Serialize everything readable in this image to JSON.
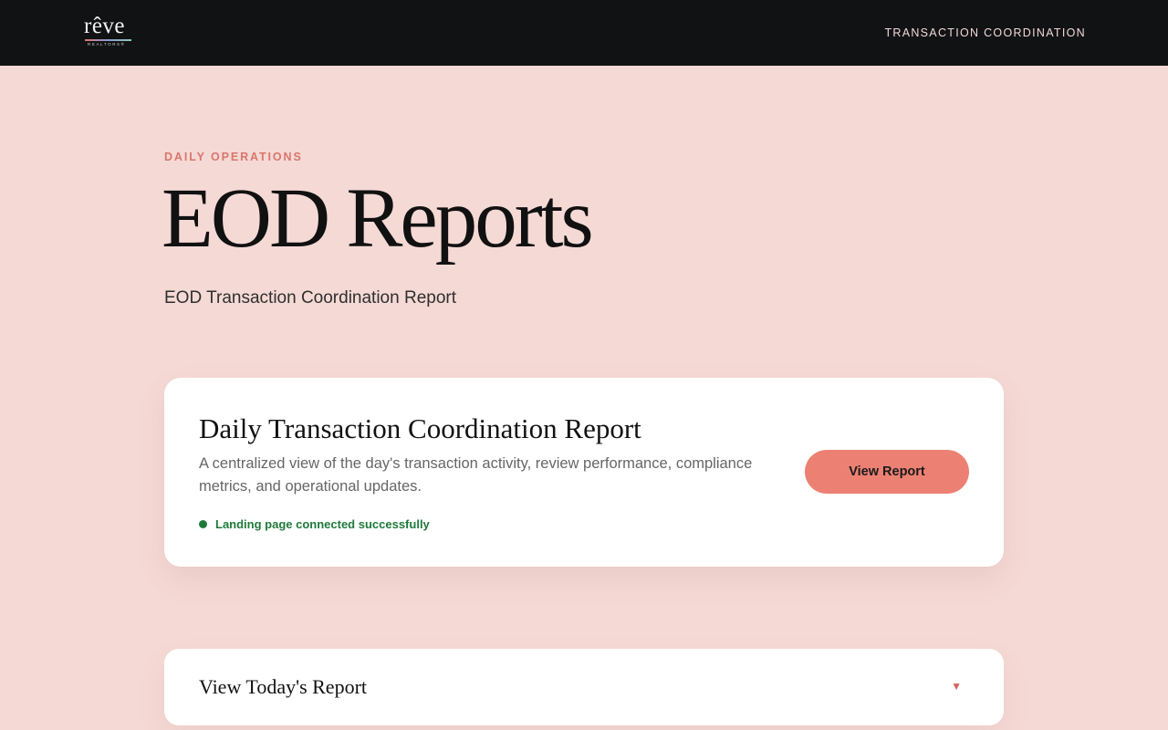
{
  "header": {
    "logo": {
      "wordmark": "rêve",
      "subtext": "REALTORS®"
    },
    "nav_link": "TRANSACTION COORDINATION"
  },
  "hero": {
    "eyebrow": "DAILY OPERATIONS",
    "title": "EOD Reports",
    "subtitle": "EOD Transaction Coordination Report"
  },
  "report_card": {
    "title": "Daily Transaction Coordination Report",
    "description": "A centralized view of the day's transaction activity, review performance, compliance metrics, and operational updates.",
    "status_text": "Landing page connected successfully",
    "status_color": "#1f7a3a",
    "button_label": "View Report"
  },
  "accordion": {
    "title": "View Today's Report",
    "caret_icon": "caret-down-icon",
    "expanded": false
  },
  "theme": {
    "background": "#f5d9d5",
    "header_bg": "#111214",
    "accent": "#d8766b",
    "button_bg": "#ec8173"
  }
}
